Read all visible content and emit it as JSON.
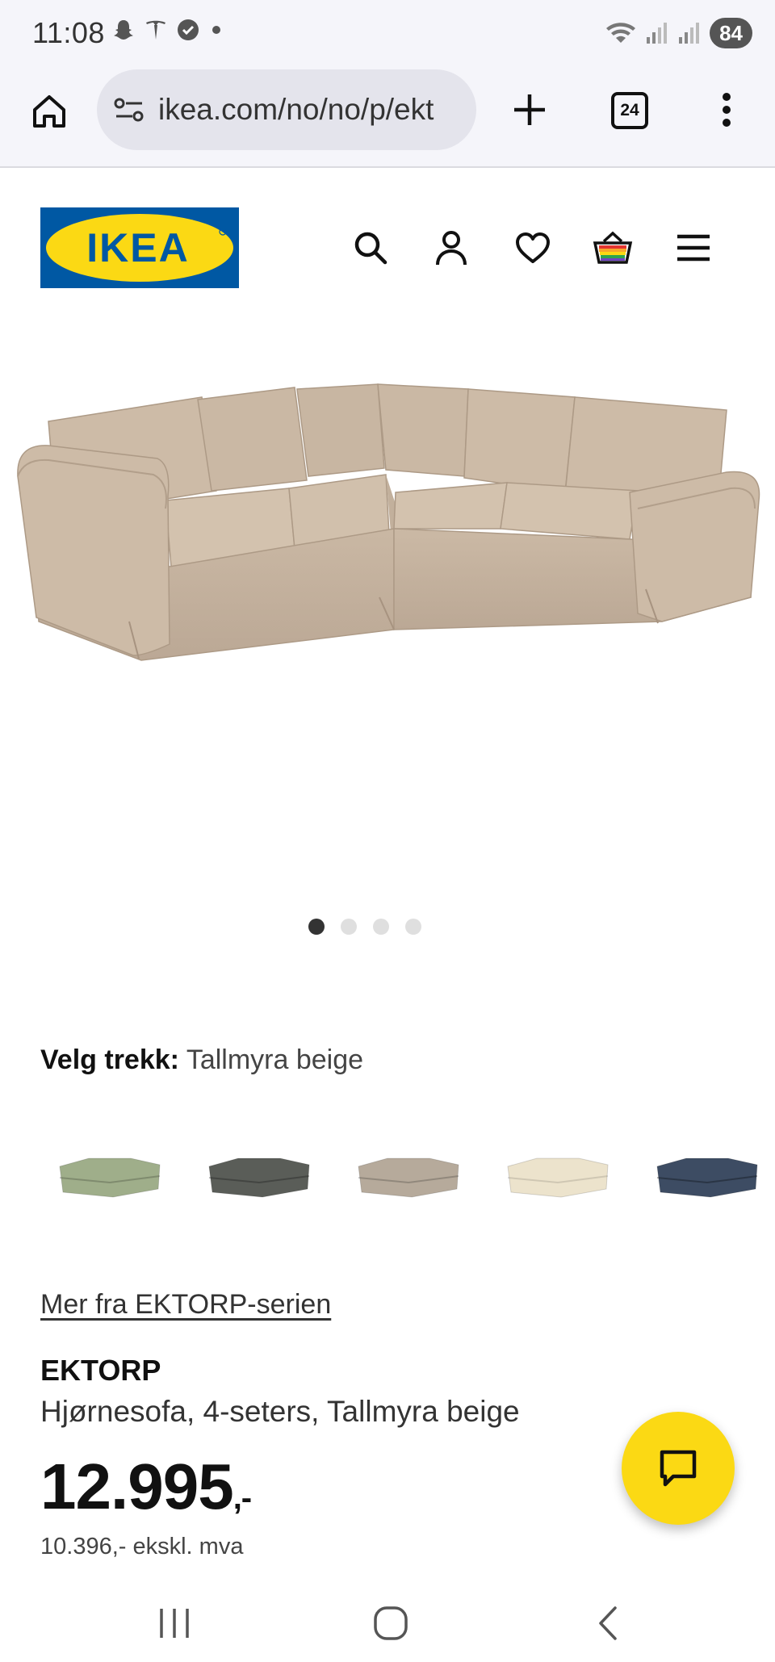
{
  "status_bar": {
    "time": "11:08",
    "battery": "84"
  },
  "browser": {
    "url": "ikea.com/no/no/p/ekt",
    "tab_count": "24"
  },
  "header": {
    "logo_text": "IKEA",
    "icons": [
      "search-icon",
      "account-icon",
      "heart-icon",
      "cart-icon",
      "menu-icon"
    ]
  },
  "gallery": {
    "image_count": 4,
    "active_index": 0
  },
  "cover": {
    "label": "Velg trekk:",
    "selected": "Tallmyra beige",
    "swatches": [
      {
        "color": "#9fae8a"
      },
      {
        "color": "#5a5d58"
      },
      {
        "color": "#b6aa9b"
      },
      {
        "color": "#ece3cc"
      },
      {
        "color": "#3d4c63"
      }
    ]
  },
  "product": {
    "series_link": "Mer fra EKTORP-serien",
    "name": "EKTORP",
    "description": "Hjørnesofa, 4-seters, Tallmyra beige",
    "price": "12.995",
    "price_suffix": ",-",
    "price_ex_vat": "10.396,- ekskl. mva"
  },
  "colors": {
    "ikea_blue": "#0058a3",
    "ikea_yellow": "#fbd914",
    "sofa_beige": "#c9b7a2"
  }
}
